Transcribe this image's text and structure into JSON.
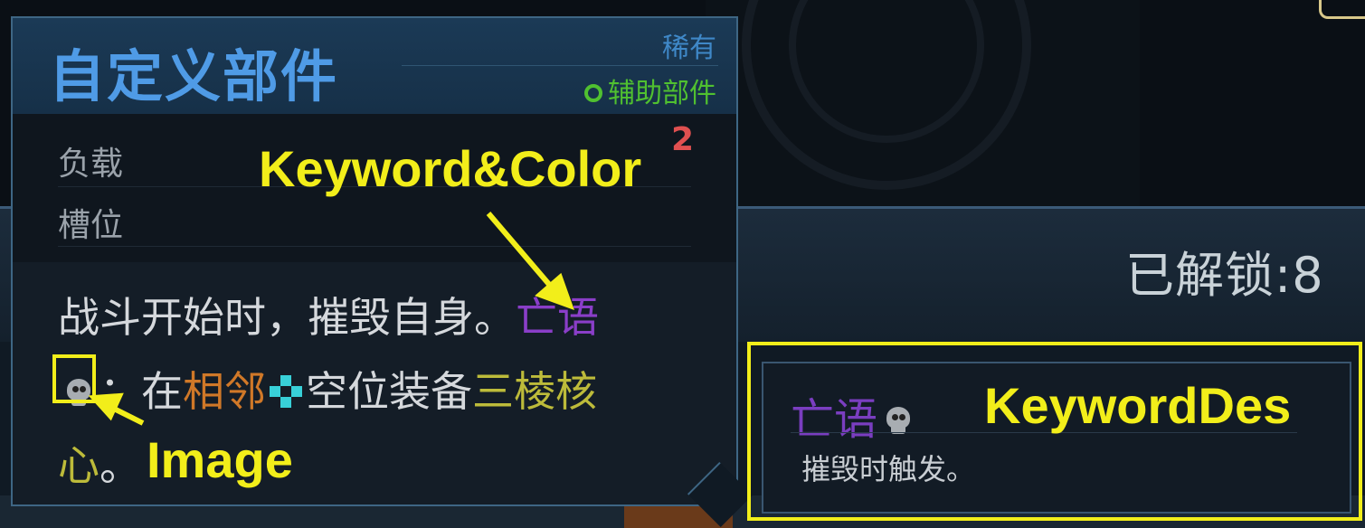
{
  "background": {
    "unlocked_label": "已解锁:",
    "unlocked_value": "8"
  },
  "tooltip": {
    "title": "自定义部件",
    "rarity": "稀有",
    "type_label": "辅助部件",
    "type_icon": "gear-icon",
    "stats": [
      {
        "label": "负载"
      },
      {
        "label": "槽位"
      }
    ],
    "stat_value": "2",
    "description": {
      "part1": "战斗开始时，摧毁自身。",
      "keyword": "亡语",
      "part2": "：在",
      "adjacent": "相邻",
      "part3": "空位装备",
      "core": "三棱核心",
      "core_line1": "三棱核",
      "core_line2": "心",
      "end": "。"
    }
  },
  "keyword_panel": {
    "title": "亡语",
    "text": "摧毁时触发。"
  },
  "annotations": {
    "keyword_color": "Keyword&Color",
    "image": "Image",
    "keyword_des": "KeywordDes",
    "color": "#f2ee1a"
  },
  "colors": {
    "title": "#4f9be6",
    "rarity": "#3f88c8",
    "type": "#50c030",
    "keyword": "#8a3ec8",
    "adjacent": "#d07828",
    "core": "#bdbb3a",
    "stat_value": "#e05050"
  }
}
